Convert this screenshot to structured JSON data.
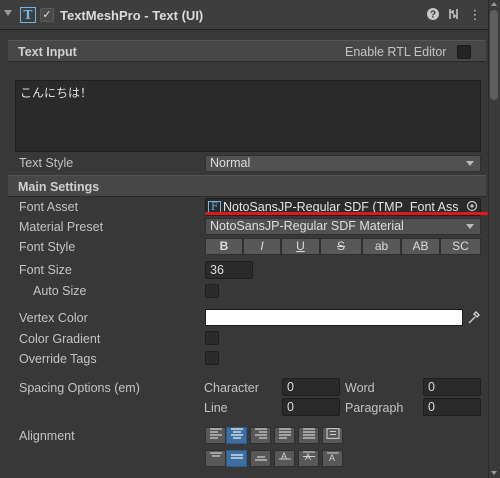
{
  "header": {
    "title": "TextMeshPro - Text (UI)",
    "enabled": true
  },
  "text_input": {
    "section_title": "Text Input",
    "rtl_label": "Enable RTL Editor",
    "text": "こんにちは！"
  },
  "text_style": {
    "label": "Text Style",
    "value": "Normal"
  },
  "main_settings": {
    "section_title": "Main Settings",
    "font_asset": {
      "label": "Font Asset",
      "value": "NotoSansJP-Regular SDF (TMP_Font Ass",
      "icon": "F"
    },
    "material_preset": {
      "label": "Material Preset",
      "value": "NotoSansJP-Regular SDF Material"
    },
    "font_style": {
      "label": "Font Style",
      "buttons": [
        "B",
        "I",
        "U",
        "S",
        "ab",
        "AB",
        "SC"
      ]
    },
    "font_size": {
      "label": "Font Size",
      "value": "36"
    },
    "auto_size": {
      "label": "Auto Size"
    },
    "vertex_color": {
      "label": "Vertex Color",
      "color": "#ffffff"
    },
    "color_gradient": {
      "label": "Color Gradient"
    },
    "override_tags": {
      "label": "Override Tags"
    },
    "spacing": {
      "label": "Spacing Options (em)",
      "character_label": "Character",
      "character_value": "0",
      "word_label": "Word",
      "word_value": "0",
      "line_label": "Line",
      "line_value": "0",
      "paragraph_label": "Paragraph",
      "paragraph_value": "0"
    },
    "alignment": {
      "label": "Alignment"
    }
  },
  "colors": {
    "highlight_underline": "#e01818",
    "accent_selected": "#3d6fa0"
  }
}
